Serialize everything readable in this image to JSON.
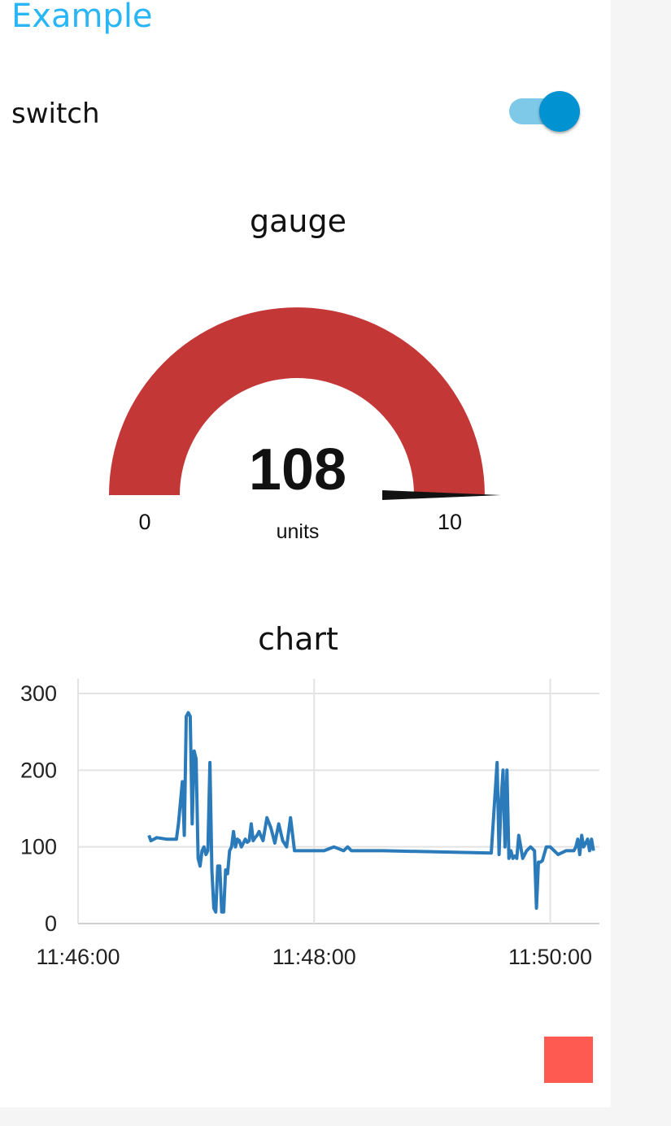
{
  "group": {
    "title": "Example"
  },
  "switch": {
    "label": "switch",
    "checked": true,
    "track_color": "#7ec8e8",
    "thumb_color": "#0192d1"
  },
  "gauge": {
    "title": "gauge",
    "value": "108",
    "units": "units",
    "min": "0",
    "max": "10",
    "arc_color": "#c43737",
    "needle_color": "#111111"
  },
  "chart": {
    "title": "chart"
  },
  "indicator": {
    "color": "#ff5a52"
  },
  "chart_data": {
    "type": "line",
    "title": "chart",
    "xlabel": "",
    "ylabel": "",
    "x_ticks": [
      "11:46:00",
      "11:48:00",
      "11:50:00"
    ],
    "y_ticks": [
      "300",
      "200",
      "100",
      "0"
    ],
    "xlim": [
      "11:46:00",
      "11:50:25"
    ],
    "ylim": [
      0,
      300
    ],
    "grid": true,
    "legend": "none",
    "series": [
      {
        "color": "#2b7bba",
        "x": [
          "11:46:36",
          "11:46:37",
          "11:46:40",
          "11:46:45",
          "11:46:50",
          "11:46:51",
          "11:46:53",
          "11:46:54",
          "11:46:55",
          "11:46:56",
          "11:46:57",
          "11:46:58",
          "11:46:59",
          "11:47:00",
          "11:47:01",
          "11:47:02",
          "11:47:03",
          "11:47:04",
          "11:47:05",
          "11:47:06",
          "11:47:07",
          "11:47:08",
          "11:47:09",
          "11:47:10",
          "11:47:11",
          "11:47:12",
          "11:47:13",
          "11:47:14",
          "11:47:15",
          "11:47:16",
          "11:47:17",
          "11:47:18",
          "11:47:19",
          "11:47:20",
          "11:47:21",
          "11:47:22",
          "11:47:23",
          "11:47:24",
          "11:47:25",
          "11:47:26",
          "11:47:27",
          "11:47:28",
          "11:47:29",
          "11:47:30",
          "11:47:31",
          "11:47:32",
          "11:47:34",
          "11:47:36",
          "11:47:38",
          "11:47:40",
          "11:47:42",
          "11:47:44",
          "11:47:46",
          "11:47:48",
          "11:47:50",
          "11:47:52",
          "11:47:54",
          "11:47:56",
          "11:47:58",
          "11:48:00",
          "11:48:05",
          "11:48:10",
          "11:48:15",
          "11:48:17",
          "11:48:19",
          "11:48:25",
          "11:48:30",
          "11:48:35",
          "11:49:30",
          "11:49:33",
          "11:49:34",
          "11:49:35",
          "11:49:36",
          "11:49:37",
          "11:49:38",
          "11:49:39",
          "11:49:40",
          "11:49:41",
          "11:49:42",
          "11:49:43",
          "11:49:44",
          "11:49:46",
          "11:49:48",
          "11:49:50",
          "11:49:52",
          "11:49:53",
          "11:49:54",
          "11:49:55",
          "11:49:56",
          "11:49:58",
          "11:50:00",
          "11:50:04",
          "11:50:08",
          "11:50:12",
          "11:50:13",
          "11:50:14",
          "11:50:15",
          "11:50:16",
          "11:50:17",
          "11:50:18",
          "11:50:19",
          "11:50:20",
          "11:50:21",
          "11:50:22"
        ],
        "y": [
          115,
          108,
          112,
          110,
          110,
          130,
          185,
          115,
          270,
          275,
          270,
          130,
          225,
          215,
          85,
          75,
          95,
          100,
          90,
          95,
          210,
          70,
          20,
          15,
          75,
          75,
          15,
          15,
          70,
          65,
          95,
          100,
          120,
          100,
          110,
          108,
          100,
          105,
          110,
          106,
          108,
          130,
          108,
          112,
          115,
          120,
          108,
          138,
          125,
          105,
          130,
          108,
          100,
          138,
          95,
          95,
          95,
          95,
          95,
          95,
          95,
          100,
          95,
          100,
          95,
          95,
          95,
          95,
          92,
          210,
          90,
          160,
          200,
          100,
          200,
          85,
          95,
          85,
          88,
          85,
          115,
          85,
          95,
          100,
          95,
          20,
          80,
          80,
          82,
          100,
          100,
          90,
          95,
          95,
          100,
          110,
          90,
          115,
          100,
          105,
          110,
          95,
          110,
          95
        ]
      }
    ]
  }
}
